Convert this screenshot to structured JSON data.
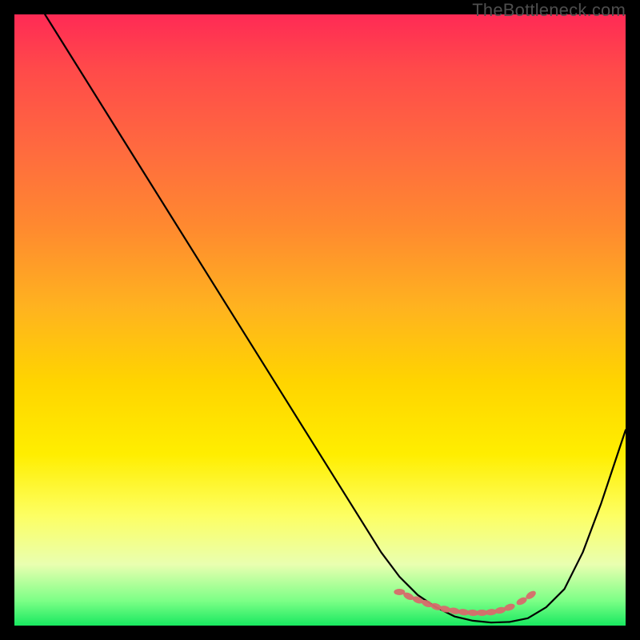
{
  "attribution": "TheBottleneck.com",
  "colors": {
    "background": "#000000",
    "gradient_top": "#ff2a55",
    "gradient_mid1": "#ff8a2f",
    "gradient_mid2": "#ffee00",
    "gradient_bottom": "#18e860",
    "curve": "#000000",
    "marker": "#d76b6b"
  },
  "chart_data": {
    "type": "line",
    "title": "",
    "xlabel": "",
    "ylabel": "",
    "xlim": [
      0,
      100
    ],
    "ylim": [
      0,
      100
    ],
    "legend": false,
    "grid": false,
    "series": [
      {
        "name": "bottleneck-curve",
        "x": [
          5,
          10,
          15,
          20,
          25,
          30,
          35,
          40,
          45,
          50,
          55,
          60,
          63,
          66,
          69,
          72,
          75,
          78,
          81,
          84,
          87,
          90,
          93,
          96,
          100
        ],
        "values": [
          100,
          92,
          84,
          76,
          68,
          60,
          52,
          44,
          36,
          28,
          20,
          12,
          8,
          5,
          3,
          1.5,
          0.8,
          0.5,
          0.6,
          1.2,
          3,
          6,
          12,
          20,
          32
        ]
      }
    ],
    "markers": {
      "name": "dotted-minimum",
      "x": [
        63,
        64.5,
        66,
        67.5,
        69,
        70.5,
        72,
        73.5,
        75,
        76.5,
        78,
        79.5,
        81,
        83,
        84.5
      ],
      "values": [
        5.5,
        4.8,
        4.2,
        3.6,
        3.1,
        2.7,
        2.4,
        2.2,
        2.1,
        2.1,
        2.2,
        2.5,
        3.0,
        4.0,
        5.0
      ]
    }
  }
}
